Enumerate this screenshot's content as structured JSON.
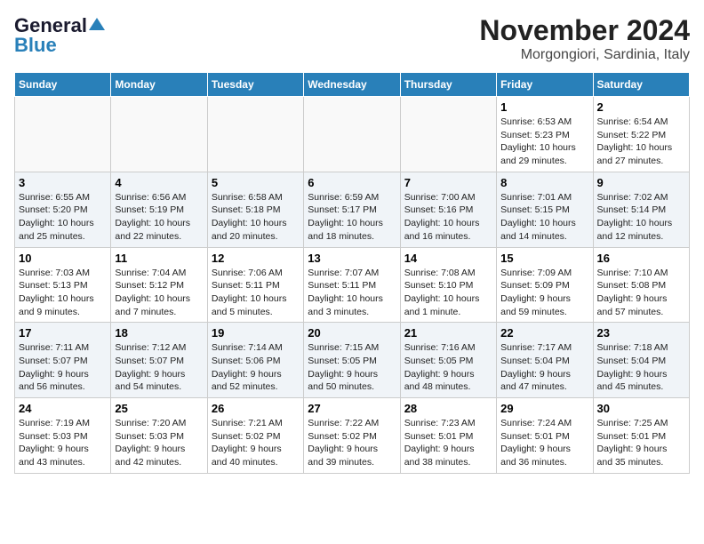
{
  "header": {
    "logo_line1": "General",
    "logo_line2": "Blue",
    "month": "November 2024",
    "location": "Morgongiori, Sardinia, Italy"
  },
  "days_of_week": [
    "Sunday",
    "Monday",
    "Tuesday",
    "Wednesday",
    "Thursday",
    "Friday",
    "Saturday"
  ],
  "weeks": [
    {
      "shade": false,
      "days": [
        {
          "num": "",
          "info": ""
        },
        {
          "num": "",
          "info": ""
        },
        {
          "num": "",
          "info": ""
        },
        {
          "num": "",
          "info": ""
        },
        {
          "num": "",
          "info": ""
        },
        {
          "num": "1",
          "info": "Sunrise: 6:53 AM\nSunset: 5:23 PM\nDaylight: 10 hours\nand 29 minutes."
        },
        {
          "num": "2",
          "info": "Sunrise: 6:54 AM\nSunset: 5:22 PM\nDaylight: 10 hours\nand 27 minutes."
        }
      ]
    },
    {
      "shade": true,
      "days": [
        {
          "num": "3",
          "info": "Sunrise: 6:55 AM\nSunset: 5:20 PM\nDaylight: 10 hours\nand 25 minutes."
        },
        {
          "num": "4",
          "info": "Sunrise: 6:56 AM\nSunset: 5:19 PM\nDaylight: 10 hours\nand 22 minutes."
        },
        {
          "num": "5",
          "info": "Sunrise: 6:58 AM\nSunset: 5:18 PM\nDaylight: 10 hours\nand 20 minutes."
        },
        {
          "num": "6",
          "info": "Sunrise: 6:59 AM\nSunset: 5:17 PM\nDaylight: 10 hours\nand 18 minutes."
        },
        {
          "num": "7",
          "info": "Sunrise: 7:00 AM\nSunset: 5:16 PM\nDaylight: 10 hours\nand 16 minutes."
        },
        {
          "num": "8",
          "info": "Sunrise: 7:01 AM\nSunset: 5:15 PM\nDaylight: 10 hours\nand 14 minutes."
        },
        {
          "num": "9",
          "info": "Sunrise: 7:02 AM\nSunset: 5:14 PM\nDaylight: 10 hours\nand 12 minutes."
        }
      ]
    },
    {
      "shade": false,
      "days": [
        {
          "num": "10",
          "info": "Sunrise: 7:03 AM\nSunset: 5:13 PM\nDaylight: 10 hours\nand 9 minutes."
        },
        {
          "num": "11",
          "info": "Sunrise: 7:04 AM\nSunset: 5:12 PM\nDaylight: 10 hours\nand 7 minutes."
        },
        {
          "num": "12",
          "info": "Sunrise: 7:06 AM\nSunset: 5:11 PM\nDaylight: 10 hours\nand 5 minutes."
        },
        {
          "num": "13",
          "info": "Sunrise: 7:07 AM\nSunset: 5:11 PM\nDaylight: 10 hours\nand 3 minutes."
        },
        {
          "num": "14",
          "info": "Sunrise: 7:08 AM\nSunset: 5:10 PM\nDaylight: 10 hours\nand 1 minute."
        },
        {
          "num": "15",
          "info": "Sunrise: 7:09 AM\nSunset: 5:09 PM\nDaylight: 9 hours\nand 59 minutes."
        },
        {
          "num": "16",
          "info": "Sunrise: 7:10 AM\nSunset: 5:08 PM\nDaylight: 9 hours\nand 57 minutes."
        }
      ]
    },
    {
      "shade": true,
      "days": [
        {
          "num": "17",
          "info": "Sunrise: 7:11 AM\nSunset: 5:07 PM\nDaylight: 9 hours\nand 56 minutes."
        },
        {
          "num": "18",
          "info": "Sunrise: 7:12 AM\nSunset: 5:07 PM\nDaylight: 9 hours\nand 54 minutes."
        },
        {
          "num": "19",
          "info": "Sunrise: 7:14 AM\nSunset: 5:06 PM\nDaylight: 9 hours\nand 52 minutes."
        },
        {
          "num": "20",
          "info": "Sunrise: 7:15 AM\nSunset: 5:05 PM\nDaylight: 9 hours\nand 50 minutes."
        },
        {
          "num": "21",
          "info": "Sunrise: 7:16 AM\nSunset: 5:05 PM\nDaylight: 9 hours\nand 48 minutes."
        },
        {
          "num": "22",
          "info": "Sunrise: 7:17 AM\nSunset: 5:04 PM\nDaylight: 9 hours\nand 47 minutes."
        },
        {
          "num": "23",
          "info": "Sunrise: 7:18 AM\nSunset: 5:04 PM\nDaylight: 9 hours\nand 45 minutes."
        }
      ]
    },
    {
      "shade": false,
      "days": [
        {
          "num": "24",
          "info": "Sunrise: 7:19 AM\nSunset: 5:03 PM\nDaylight: 9 hours\nand 43 minutes."
        },
        {
          "num": "25",
          "info": "Sunrise: 7:20 AM\nSunset: 5:03 PM\nDaylight: 9 hours\nand 42 minutes."
        },
        {
          "num": "26",
          "info": "Sunrise: 7:21 AM\nSunset: 5:02 PM\nDaylight: 9 hours\nand 40 minutes."
        },
        {
          "num": "27",
          "info": "Sunrise: 7:22 AM\nSunset: 5:02 PM\nDaylight: 9 hours\nand 39 minutes."
        },
        {
          "num": "28",
          "info": "Sunrise: 7:23 AM\nSunset: 5:01 PM\nDaylight: 9 hours\nand 38 minutes."
        },
        {
          "num": "29",
          "info": "Sunrise: 7:24 AM\nSunset: 5:01 PM\nDaylight: 9 hours\nand 36 minutes."
        },
        {
          "num": "30",
          "info": "Sunrise: 7:25 AM\nSunset: 5:01 PM\nDaylight: 9 hours\nand 35 minutes."
        }
      ]
    }
  ]
}
